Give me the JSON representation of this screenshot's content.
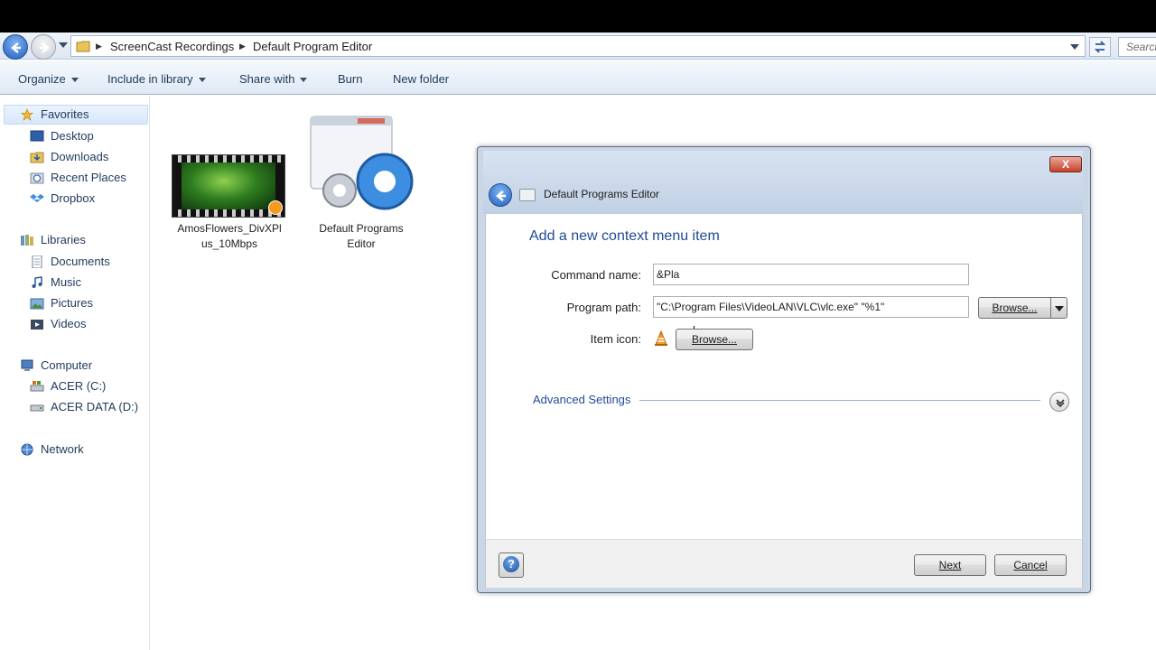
{
  "explorer": {
    "breadcrumb": [
      "ScreenCast Recordings",
      "Default Program Editor"
    ],
    "search_placeholder": "Search",
    "toolbar": {
      "organize": "Organize",
      "include_in_library": "Include in library",
      "share_with": "Share with",
      "burn": "Burn",
      "new_folder": "New folder"
    },
    "nav": {
      "favorites": "Favorites",
      "desktop": "Desktop",
      "downloads": "Downloads",
      "recent_places": "Recent Places",
      "dropbox": "Dropbox",
      "libraries": "Libraries",
      "documents": "Documents",
      "music": "Music",
      "pictures": "Pictures",
      "videos": "Videos",
      "computer": "Computer",
      "drive_c": "ACER (C:)",
      "drive_d": "ACER DATA (D:)",
      "network": "Network"
    },
    "files": [
      {
        "name_line1": "AmosFlowers_DivXPl",
        "name_line2": "us_10Mbps",
        "icon": "video-thumbnail"
      },
      {
        "name_line1": "Default Programs",
        "name_line2": "Editor",
        "icon": "application-icon"
      }
    ]
  },
  "dialog": {
    "title": "Default Programs Editor",
    "close_label": "X",
    "instruction": "Add a new context menu item",
    "command_name_label": "Command name:",
    "command_name_value": "&Pla",
    "program_path_label": "Program path:",
    "program_path_value": "\"C:\\Program Files\\VideoLAN\\VLC\\vlc.exe\" \"%1\"",
    "browse_label": "Browse...",
    "item_icon_label": "Item icon:",
    "item_icon_name": "vlc-cone-icon",
    "item_icon_browse_label": "Browse...",
    "advanced_settings": "Advanced Settings",
    "help_label": "?",
    "next_label": "Next",
    "cancel_label": "Cancel"
  },
  "colors": {
    "accent_blue": "#1e4a94",
    "close_red": "#c7412a",
    "vlc_orange": "#f39a1f"
  }
}
